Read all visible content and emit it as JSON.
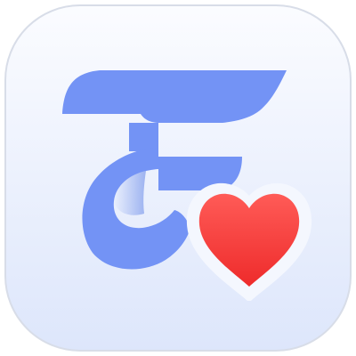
{
  "app_icon": {
    "icon_name": "app-logo-letter-f-with-heart-icon",
    "colors": {
      "background_top": "#fbfcff",
      "background_bottom": "#dde6fb",
      "border": "#d8dde8",
      "letter": "#7393f5",
      "letter_shade": "#5b7fe6",
      "heart_top": "#ff5b57",
      "heart_bottom": "#ee2b2b"
    },
    "heart_icon": "heart-icon"
  }
}
